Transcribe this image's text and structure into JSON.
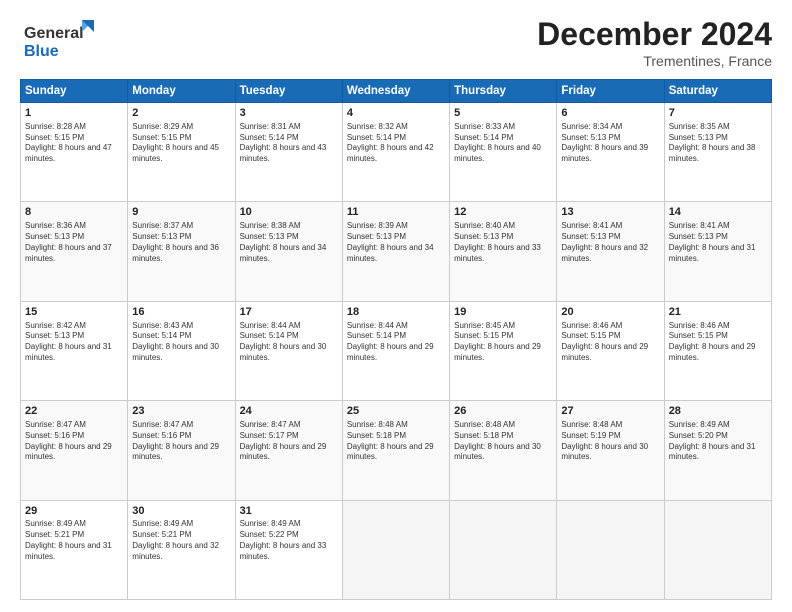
{
  "header": {
    "logo_line1": "General",
    "logo_line2": "Blue",
    "title": "December 2024",
    "subtitle": "Trementines, France"
  },
  "columns": [
    "Sunday",
    "Monday",
    "Tuesday",
    "Wednesday",
    "Thursday",
    "Friday",
    "Saturday"
  ],
  "weeks": [
    [
      {
        "num": "1",
        "sunrise": "Sunrise: 8:28 AM",
        "sunset": "Sunset: 5:15 PM",
        "daylight": "Daylight: 8 hours and 47 minutes."
      },
      {
        "num": "2",
        "sunrise": "Sunrise: 8:29 AM",
        "sunset": "Sunset: 5:15 PM",
        "daylight": "Daylight: 8 hours and 45 minutes."
      },
      {
        "num": "3",
        "sunrise": "Sunrise: 8:31 AM",
        "sunset": "Sunset: 5:14 PM",
        "daylight": "Daylight: 8 hours and 43 minutes."
      },
      {
        "num": "4",
        "sunrise": "Sunrise: 8:32 AM",
        "sunset": "Sunset: 5:14 PM",
        "daylight": "Daylight: 8 hours and 42 minutes."
      },
      {
        "num": "5",
        "sunrise": "Sunrise: 8:33 AM",
        "sunset": "Sunset: 5:14 PM",
        "daylight": "Daylight: 8 hours and 40 minutes."
      },
      {
        "num": "6",
        "sunrise": "Sunrise: 8:34 AM",
        "sunset": "Sunset: 5:13 PM",
        "daylight": "Daylight: 8 hours and 39 minutes."
      },
      {
        "num": "7",
        "sunrise": "Sunrise: 8:35 AM",
        "sunset": "Sunset: 5:13 PM",
        "daylight": "Daylight: 8 hours and 38 minutes."
      }
    ],
    [
      {
        "num": "8",
        "sunrise": "Sunrise: 8:36 AM",
        "sunset": "Sunset: 5:13 PM",
        "daylight": "Daylight: 8 hours and 37 minutes."
      },
      {
        "num": "9",
        "sunrise": "Sunrise: 8:37 AM",
        "sunset": "Sunset: 5:13 PM",
        "daylight": "Daylight: 8 hours and 36 minutes."
      },
      {
        "num": "10",
        "sunrise": "Sunrise: 8:38 AM",
        "sunset": "Sunset: 5:13 PM",
        "daylight": "Daylight: 8 hours and 34 minutes."
      },
      {
        "num": "11",
        "sunrise": "Sunrise: 8:39 AM",
        "sunset": "Sunset: 5:13 PM",
        "daylight": "Daylight: 8 hours and 34 minutes."
      },
      {
        "num": "12",
        "sunrise": "Sunrise: 8:40 AM",
        "sunset": "Sunset: 5:13 PM",
        "daylight": "Daylight: 8 hours and 33 minutes."
      },
      {
        "num": "13",
        "sunrise": "Sunrise: 8:41 AM",
        "sunset": "Sunset: 5:13 PM",
        "daylight": "Daylight: 8 hours and 32 minutes."
      },
      {
        "num": "14",
        "sunrise": "Sunrise: 8:41 AM",
        "sunset": "Sunset: 5:13 PM",
        "daylight": "Daylight: 8 hours and 31 minutes."
      }
    ],
    [
      {
        "num": "15",
        "sunrise": "Sunrise: 8:42 AM",
        "sunset": "Sunset: 5:13 PM",
        "daylight": "Daylight: 8 hours and 31 minutes."
      },
      {
        "num": "16",
        "sunrise": "Sunrise: 8:43 AM",
        "sunset": "Sunset: 5:14 PM",
        "daylight": "Daylight: 8 hours and 30 minutes."
      },
      {
        "num": "17",
        "sunrise": "Sunrise: 8:44 AM",
        "sunset": "Sunset: 5:14 PM",
        "daylight": "Daylight: 8 hours and 30 minutes."
      },
      {
        "num": "18",
        "sunrise": "Sunrise: 8:44 AM",
        "sunset": "Sunset: 5:14 PM",
        "daylight": "Daylight: 8 hours and 29 minutes."
      },
      {
        "num": "19",
        "sunrise": "Sunrise: 8:45 AM",
        "sunset": "Sunset: 5:15 PM",
        "daylight": "Daylight: 8 hours and 29 minutes."
      },
      {
        "num": "20",
        "sunrise": "Sunrise: 8:46 AM",
        "sunset": "Sunset: 5:15 PM",
        "daylight": "Daylight: 8 hours and 29 minutes."
      },
      {
        "num": "21",
        "sunrise": "Sunrise: 8:46 AM",
        "sunset": "Sunset: 5:15 PM",
        "daylight": "Daylight: 8 hours and 29 minutes."
      }
    ],
    [
      {
        "num": "22",
        "sunrise": "Sunrise: 8:47 AM",
        "sunset": "Sunset: 5:16 PM",
        "daylight": "Daylight: 8 hours and 29 minutes."
      },
      {
        "num": "23",
        "sunrise": "Sunrise: 8:47 AM",
        "sunset": "Sunset: 5:16 PM",
        "daylight": "Daylight: 8 hours and 29 minutes."
      },
      {
        "num": "24",
        "sunrise": "Sunrise: 8:47 AM",
        "sunset": "Sunset: 5:17 PM",
        "daylight": "Daylight: 8 hours and 29 minutes."
      },
      {
        "num": "25",
        "sunrise": "Sunrise: 8:48 AM",
        "sunset": "Sunset: 5:18 PM",
        "daylight": "Daylight: 8 hours and 29 minutes."
      },
      {
        "num": "26",
        "sunrise": "Sunrise: 8:48 AM",
        "sunset": "Sunset: 5:18 PM",
        "daylight": "Daylight: 8 hours and 30 minutes."
      },
      {
        "num": "27",
        "sunrise": "Sunrise: 8:48 AM",
        "sunset": "Sunset: 5:19 PM",
        "daylight": "Daylight: 8 hours and 30 minutes."
      },
      {
        "num": "28",
        "sunrise": "Sunrise: 8:49 AM",
        "sunset": "Sunset: 5:20 PM",
        "daylight": "Daylight: 8 hours and 31 minutes."
      }
    ],
    [
      {
        "num": "29",
        "sunrise": "Sunrise: 8:49 AM",
        "sunset": "Sunset: 5:21 PM",
        "daylight": "Daylight: 8 hours and 31 minutes."
      },
      {
        "num": "30",
        "sunrise": "Sunrise: 8:49 AM",
        "sunset": "Sunset: 5:21 PM",
        "daylight": "Daylight: 8 hours and 32 minutes."
      },
      {
        "num": "31",
        "sunrise": "Sunrise: 8:49 AM",
        "sunset": "Sunset: 5:22 PM",
        "daylight": "Daylight: 8 hours and 33 minutes."
      },
      null,
      null,
      null,
      null
    ]
  ]
}
